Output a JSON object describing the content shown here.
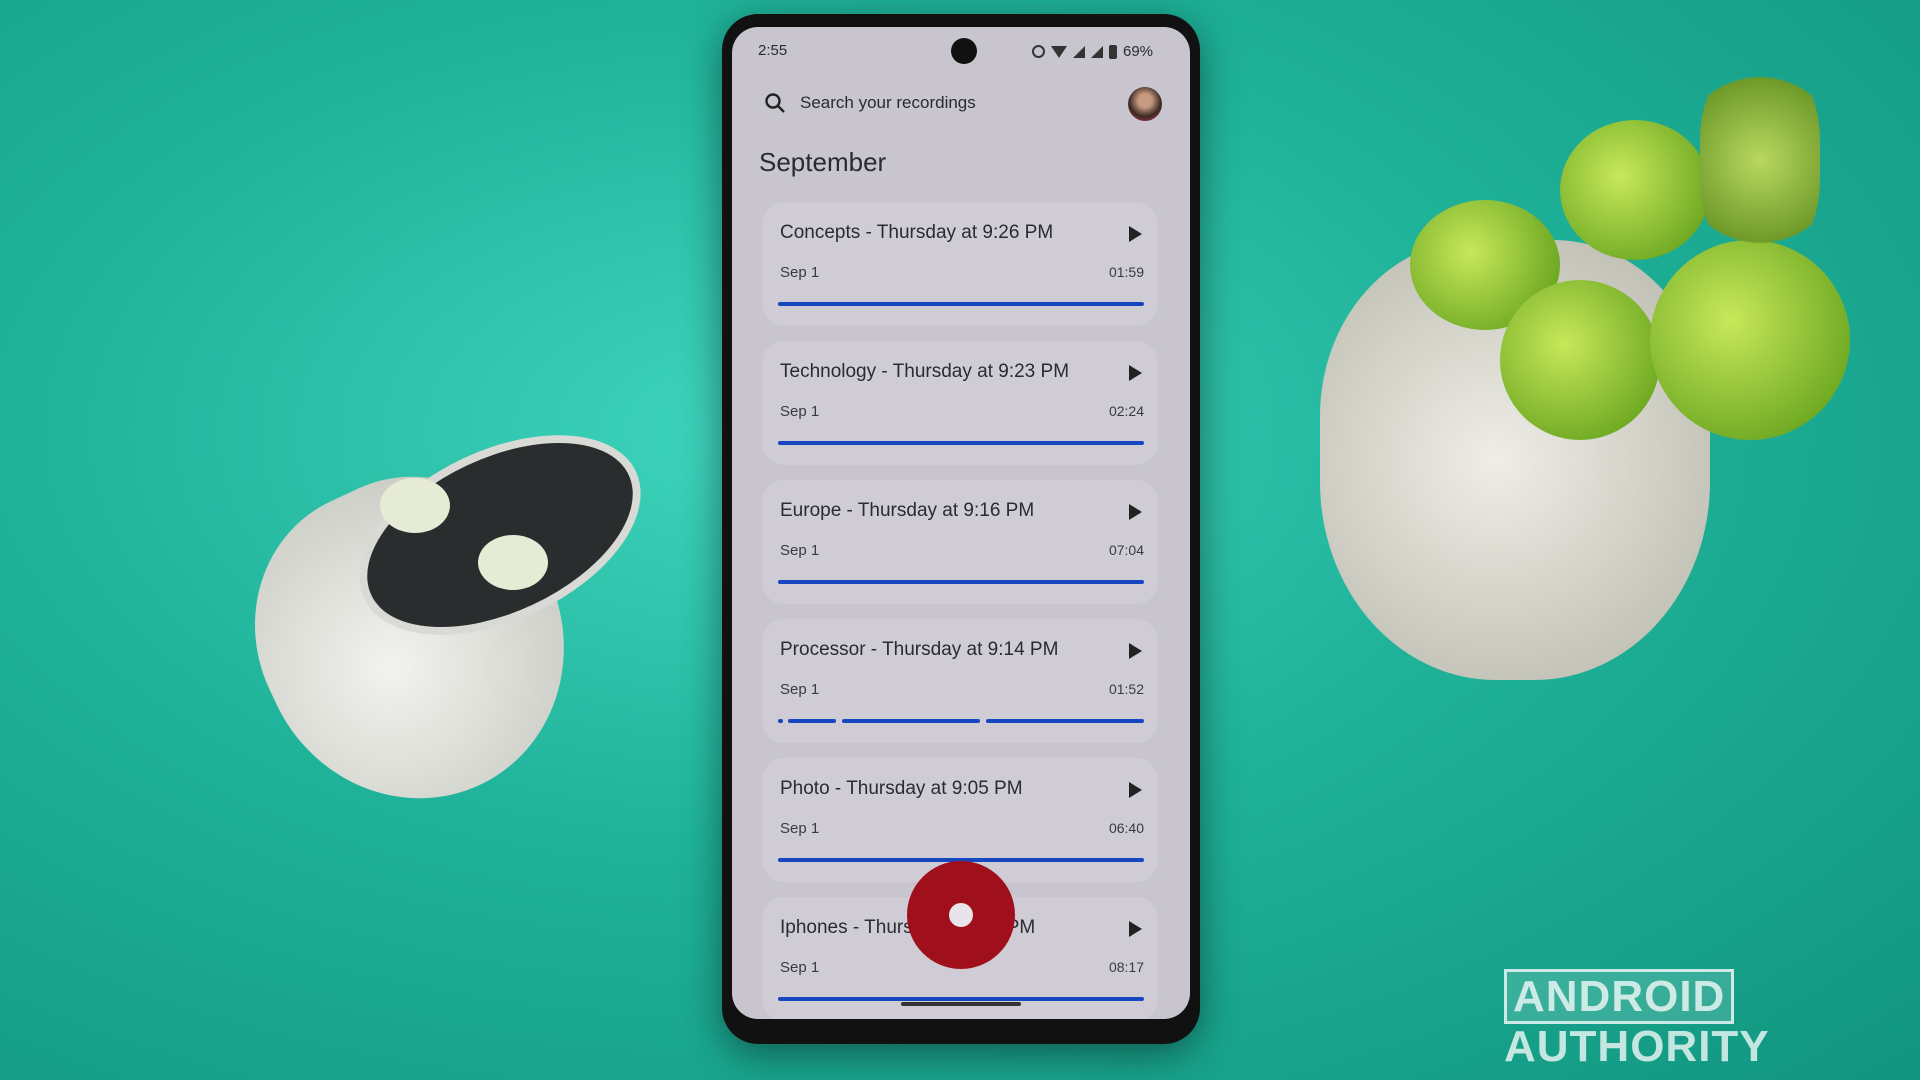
{
  "status_bar": {
    "time": "2:55",
    "battery": "69%",
    "icons": [
      "dnd-icon",
      "wifi-icon",
      "signal-icon",
      "signal-roaming-icon",
      "battery-icon"
    ]
  },
  "search": {
    "placeholder": "Search your recordings",
    "icon": "search-icon"
  },
  "section_title": "September",
  "recordings": [
    {
      "title": "Concepts - Thursday at 9:26 PM",
      "date": "Sep 1",
      "duration": "01:59"
    },
    {
      "title": "Technology - Thursday at 9:23 PM",
      "date": "Sep 1",
      "duration": "02:24"
    },
    {
      "title": "Europe - Thursday at 9:16 PM",
      "date": "Sep 1",
      "duration": "07:04"
    },
    {
      "title": "Processor - Thursday at 9:14 PM",
      "date": "Sep 1",
      "duration": "01:52"
    },
    {
      "title": "Photo - Thursday at 9:05 PM",
      "date": "Sep 1",
      "duration": "06:40"
    },
    {
      "title": "Iphones - Thursday at 9:... PM",
      "date": "Sep 1",
      "duration": "08:17"
    }
  ],
  "record_button_color": "#a0101c",
  "accent": "#1846c0",
  "watermark": {
    "part1": "ANDROID",
    "part2": "AUTHORITY"
  }
}
